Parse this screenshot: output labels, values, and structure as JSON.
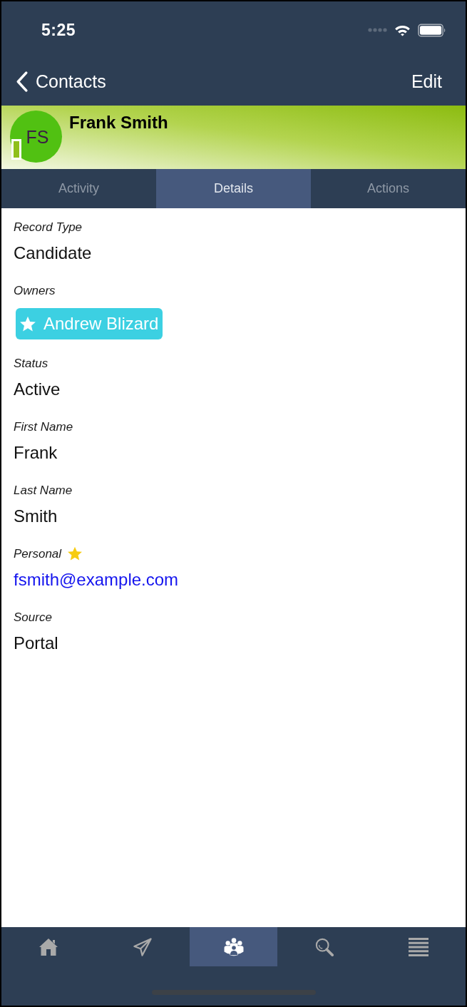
{
  "status_bar": {
    "time": "5:25"
  },
  "nav_bar": {
    "back_label": "Contacts",
    "action": "Edit"
  },
  "header": {
    "initials": "FS",
    "name": "Frank Smith"
  },
  "tabs": [
    {
      "label": "Activity",
      "selected": false
    },
    {
      "label": "Details",
      "selected": true
    },
    {
      "label": "Actions",
      "selected": false
    }
  ],
  "fields": [
    {
      "kind": "text",
      "label": "Record Type",
      "value": "Candidate",
      "starred": false
    },
    {
      "kind": "chip",
      "label": "Owners",
      "value": "Andrew Blizard",
      "starred": false
    },
    {
      "kind": "text",
      "label": "Status",
      "value": "Active",
      "starred": false
    },
    {
      "kind": "text",
      "label": "First Name",
      "value": "Frank",
      "starred": false
    },
    {
      "kind": "text",
      "label": "Last Name",
      "value": "Smith",
      "starred": false
    },
    {
      "kind": "link",
      "label": "Personal",
      "value": "fsmith@example.com",
      "starred": true
    },
    {
      "kind": "text",
      "label": "Source",
      "value": "Portal",
      "starred": false
    }
  ],
  "bottom_tabs": [
    {
      "kind": "home",
      "selected": false
    },
    {
      "kind": "send",
      "selected": false
    },
    {
      "kind": "people",
      "selected": true
    },
    {
      "kind": "search",
      "selected": false
    },
    {
      "kind": "menu",
      "selected": false
    }
  ]
}
